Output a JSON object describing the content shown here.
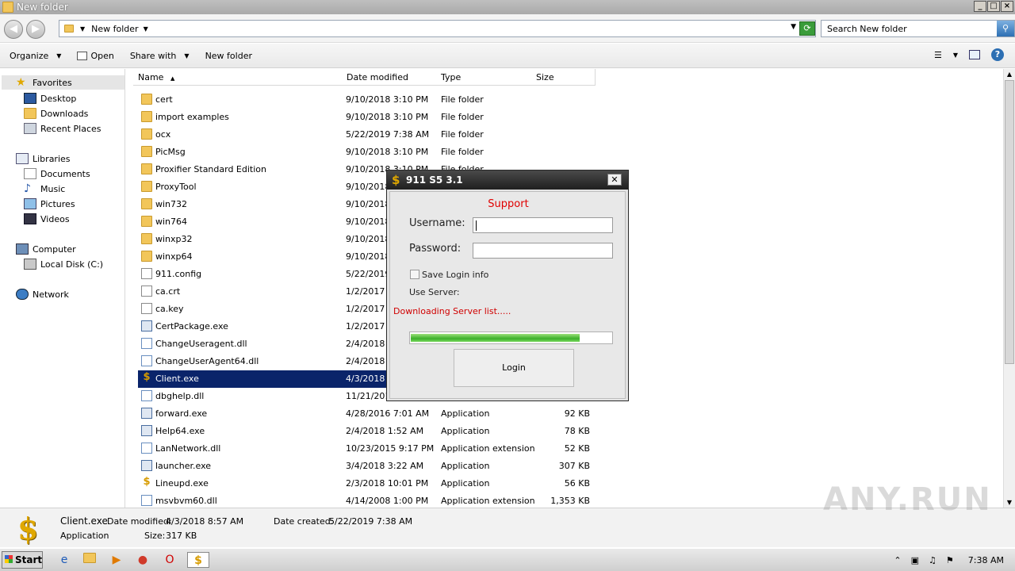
{
  "window": {
    "title": "New folder"
  },
  "address": {
    "crumb": "New folder",
    "search_placeholder": "Search New folder"
  },
  "toolbar": {
    "organize": "Organize",
    "open": "Open",
    "share_with": "Share with",
    "new_folder": "New folder"
  },
  "nav": {
    "favorites": "Favorites",
    "desktop": "Desktop",
    "downloads": "Downloads",
    "recent_places": "Recent Places",
    "libraries": "Libraries",
    "documents": "Documents",
    "music": "Music",
    "pictures": "Pictures",
    "videos": "Videos",
    "computer": "Computer",
    "local_disk": "Local Disk (C:)",
    "network": "Network"
  },
  "columns": {
    "name": "Name",
    "date": "Date modified",
    "type": "Type",
    "size": "Size"
  },
  "files": [
    {
      "name": "cert",
      "date": "9/10/2018 3:10 PM",
      "type": "File folder",
      "size": "",
      "icon": "folder"
    },
    {
      "name": "import examples",
      "date": "9/10/2018 3:10 PM",
      "type": "File folder",
      "size": "",
      "icon": "folder"
    },
    {
      "name": "ocx",
      "date": "5/22/2019 7:38 AM",
      "type": "File folder",
      "size": "",
      "icon": "folder"
    },
    {
      "name": "PicMsg",
      "date": "9/10/2018 3:10 PM",
      "type": "File folder",
      "size": "",
      "icon": "folder"
    },
    {
      "name": "Proxifier Standard Edition",
      "date": "9/10/2018 3:10 PM",
      "type": "File folder",
      "size": "",
      "icon": "folder"
    },
    {
      "name": "ProxyTool",
      "date": "9/10/2018",
      "type": "",
      "size": "",
      "icon": "folder"
    },
    {
      "name": "win732",
      "date": "9/10/2018",
      "type": "",
      "size": "",
      "icon": "folder"
    },
    {
      "name": "win764",
      "date": "9/10/2018",
      "type": "",
      "size": "",
      "icon": "folder"
    },
    {
      "name": "winxp32",
      "date": "9/10/2018",
      "type": "",
      "size": "",
      "icon": "folder"
    },
    {
      "name": "winxp64",
      "date": "9/10/2018",
      "type": "",
      "size": "",
      "icon": "folder"
    },
    {
      "name": "911.config",
      "date": "5/22/2019",
      "type": "",
      "size": "",
      "icon": "doc"
    },
    {
      "name": "ca.crt",
      "date": "1/2/2017 1",
      "type": "",
      "size": "",
      "icon": "doc"
    },
    {
      "name": "ca.key",
      "date": "1/2/2017 1",
      "type": "",
      "size": "",
      "icon": "doc"
    },
    {
      "name": "CertPackage.exe",
      "date": "1/2/2017 1",
      "type": "",
      "size": "",
      "icon": "exe"
    },
    {
      "name": "ChangeUseragent.dll",
      "date": "2/4/2018 1",
      "type": "",
      "size": "",
      "icon": "dll"
    },
    {
      "name": "ChangeUserAgent64.dll",
      "date": "2/4/2018 1",
      "type": "",
      "size": "",
      "icon": "dll"
    },
    {
      "name": "Client.exe",
      "date": "4/3/2018 8",
      "type": "",
      "size": "",
      "icon": "dollar",
      "selected": true
    },
    {
      "name": "dbghelp.dll",
      "date": "11/21/201",
      "type": "",
      "size": "",
      "icon": "dll"
    },
    {
      "name": "forward.exe",
      "date": "4/28/2016 7:01 AM",
      "type": "Application",
      "size": "92 KB",
      "icon": "exe"
    },
    {
      "name": "Help64.exe",
      "date": "2/4/2018 1:52 AM",
      "type": "Application",
      "size": "78 KB",
      "icon": "exe"
    },
    {
      "name": "LanNetwork.dll",
      "date": "10/23/2015 9:17 PM",
      "type": "Application extension",
      "size": "52 KB",
      "icon": "dll"
    },
    {
      "name": "launcher.exe",
      "date": "3/4/2018 3:22 AM",
      "type": "Application",
      "size": "307 KB",
      "icon": "exe"
    },
    {
      "name": "Lineupd.exe",
      "date": "2/3/2018 10:01 PM",
      "type": "Application",
      "size": "56 KB",
      "icon": "dollar"
    },
    {
      "name": "msvbvm60.dll",
      "date": "4/14/2008 1:00 PM",
      "type": "Application extension",
      "size": "1,353 KB",
      "icon": "dll"
    }
  ],
  "details": {
    "name": "Client.exe",
    "modified_label": "Date modified:",
    "modified": "4/3/2018 8:57 AM",
    "created_label": "Date created:",
    "created": "5/22/2019 7:38 AM",
    "type": "Application",
    "size_label": "Size:",
    "size": "317 KB"
  },
  "watermark": "ANY.RUN",
  "taskbar": {
    "start": "Start",
    "clock": "7:38 AM"
  },
  "dialog": {
    "title": "911 S5 3.1",
    "support": "Support",
    "username_label": "Username:",
    "password_label": "Password:",
    "save_login": "Save Login info",
    "use_server": "Use Server:",
    "status": "Downloading Server list.....",
    "progress": 0.84,
    "login": "Login"
  }
}
